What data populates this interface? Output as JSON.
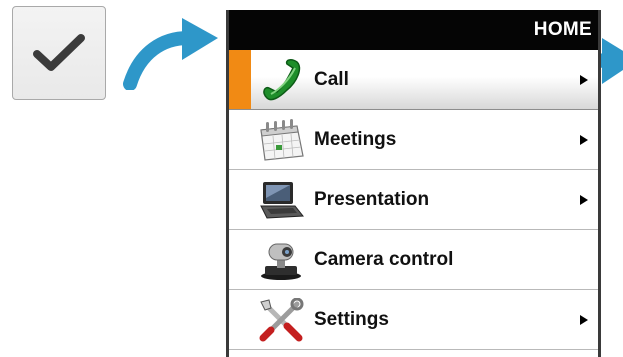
{
  "header": {
    "title": "HOME"
  },
  "menu": {
    "items": [
      {
        "label": "Call",
        "icon": "phone-icon",
        "has_submenu": true,
        "selected": true
      },
      {
        "label": "Meetings",
        "icon": "calendar-icon",
        "has_submenu": true,
        "selected": false
      },
      {
        "label": "Presentation",
        "icon": "laptop-icon",
        "has_submenu": true,
        "selected": false
      },
      {
        "label": "Camera control",
        "icon": "camera-icon",
        "has_submenu": false,
        "selected": false
      },
      {
        "label": "Settings",
        "icon": "tools-icon",
        "has_submenu": true,
        "selected": false
      }
    ]
  },
  "colors": {
    "accent": "#f18a14",
    "arrow": "#2e97c9",
    "header_bg": "#050505"
  }
}
